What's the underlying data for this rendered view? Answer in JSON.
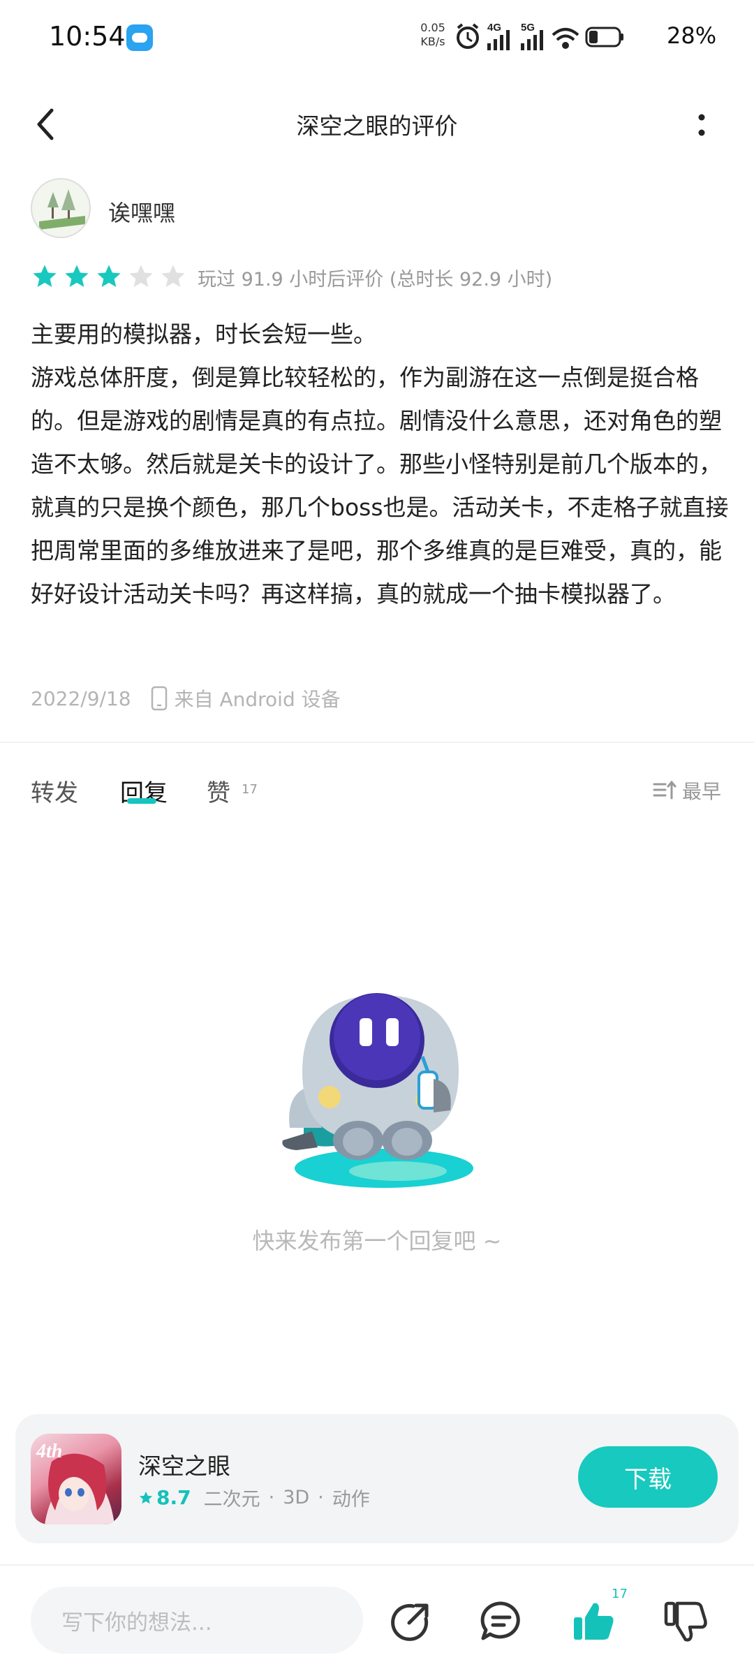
{
  "status_bar": {
    "time": "10:54",
    "net_speed_value": "0.05",
    "net_speed_unit": "KB/s",
    "signal_1": "4G",
    "signal_2": "5G",
    "battery": "28%"
  },
  "header": {
    "title": "深空之眼的评价"
  },
  "review": {
    "author": "诶嘿嘿",
    "rating": 3,
    "rating_max": 5,
    "play_info": "玩过 91.9 小时后评价 (总时长 92.9 小时)",
    "paragraphs": [
      "主要用的模拟器，时长会短一些。",
      "游戏总体肝度，倒是算比较轻松的，作为副游在这一点倒是挺合格的。但是游戏的剧情是真的有点拉。剧情没什么意思，还对角色的塑造不太够。然后就是关卡的设计了。那些小怪特别是前几个版本的，就真的只是换个颜色，那几个boss也是。活动关卡，不走格子就直接把周常里面的多维放进来了是吧，那个多维真的是巨难受，真的，能好好设计活动关卡吗？再这样搞，真的就成一个抽卡模拟器了。"
    ],
    "date": "2022/9/18",
    "device": "来自 Android 设备"
  },
  "tabs": {
    "repost": "转发",
    "reply": "回复",
    "like": "赞",
    "like_count": "17",
    "sort_label": "最早"
  },
  "empty_state": {
    "text": "快来发布第一个回复吧 ~"
  },
  "app_card": {
    "name": "深空之眼",
    "rating": "8.7",
    "tags": [
      "二次元",
      "3D",
      "动作"
    ],
    "download_label": "下载",
    "icon_text": "4th"
  },
  "bottom_bar": {
    "input_placeholder": "写下你的想法...",
    "like_count": "17"
  },
  "colors": {
    "accent": "#17c9be",
    "star_off": "#e0e0e0",
    "muted_text": "#999999"
  },
  "icons": [
    "back-arrow-icon",
    "more-vertical-icon",
    "star-icon",
    "phone-icon",
    "sort-icon",
    "share-icon",
    "comment-icon",
    "thumb-up-icon",
    "thumb-down-icon"
  ]
}
